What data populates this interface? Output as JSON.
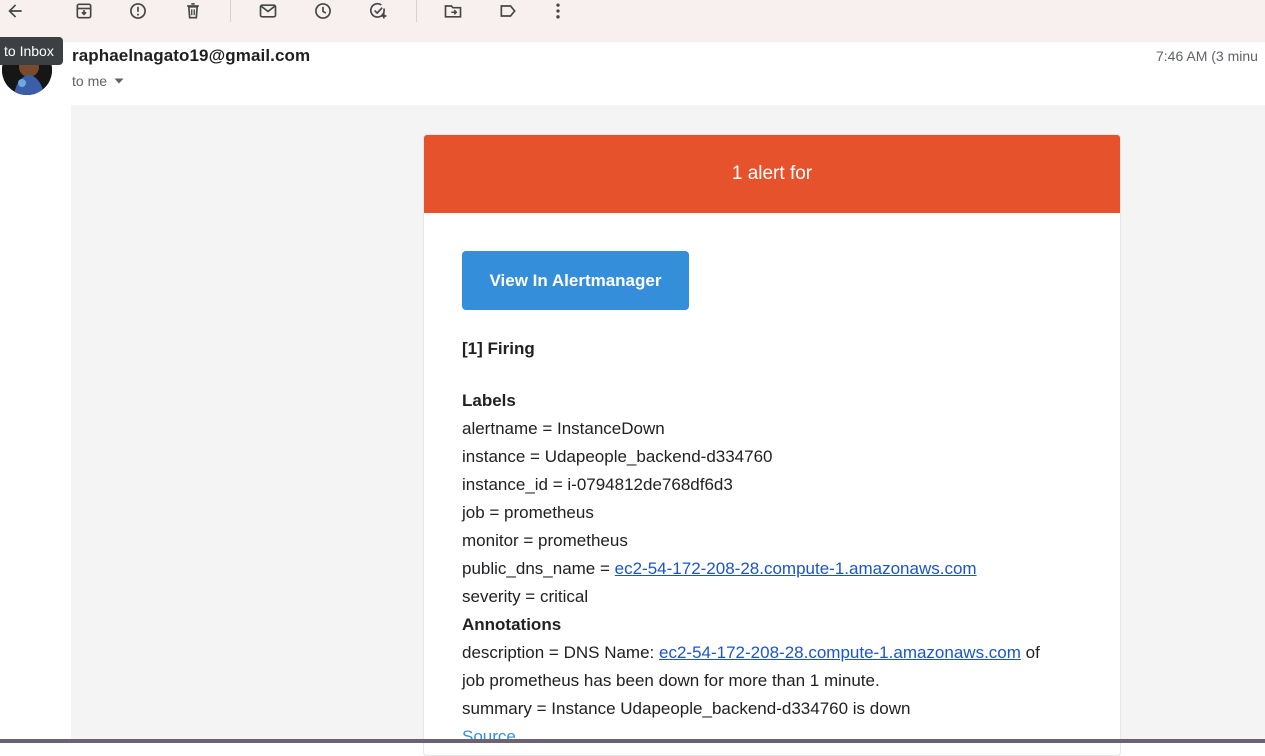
{
  "toolbar": {
    "icons": [
      "back-arrow-icon",
      "archive-icon",
      "report-spam-icon",
      "delete-icon",
      "mark-unread-icon",
      "snooze-icon",
      "add-task-icon",
      "move-to-icon",
      "label-icon",
      "more-vert-icon"
    ]
  },
  "tooltip": {
    "text": "to Inbox"
  },
  "header": {
    "sender_email": "raphaelnagato19@gmail.com",
    "to_me": "to me",
    "timestamp": "7:46 AM (3 minu"
  },
  "alert": {
    "header_text": "1 alert for",
    "button_label": "View In Alertmanager",
    "firing": "[1] Firing",
    "labels_title": "Labels",
    "labels": [
      "alertname = InstanceDown",
      "instance = Udapeople_backend-d334760",
      "instance_id = i-0794812de768df6d3",
      "job = prometheus",
      "monitor = prometheus"
    ],
    "dns_prefix": "public_dns_name = ",
    "dns_link": "ec2-54-172-208-28.compute-1.amazonaws.com",
    "severity": "severity = critical",
    "annotations_title": "Annotations",
    "description_prefix": "description = DNS Name: ",
    "description_link": "ec2-54-172-208-28.compute-1.amazonaws.com",
    "description_suffix": " of",
    "description_line2": "job prometheus has been down for more than 1 minute.",
    "summary": "summary = Instance Udapeople_backend-d334760 is down",
    "source": "Source"
  },
  "colors": {
    "alert_header": "#e6522c",
    "button": "#348eda",
    "link": "#1a55c8",
    "toolbar_bg": "#f8f0ef",
    "body_bg": "#f4f4f4"
  }
}
